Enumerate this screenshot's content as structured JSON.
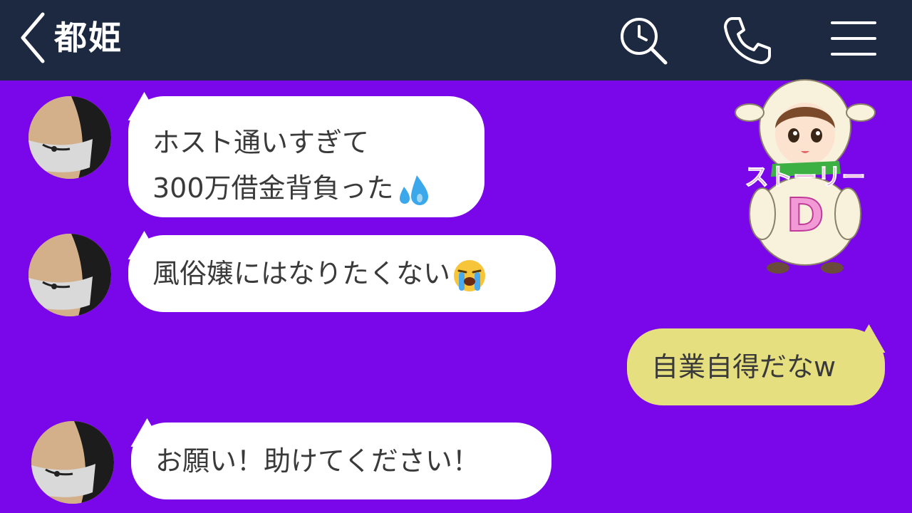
{
  "header": {
    "title": "都姫",
    "icons": [
      "chevron-left-icon",
      "search-clock-icon",
      "phone-icon",
      "menu-icon"
    ]
  },
  "colors": {
    "header_bg": "#1d2940",
    "chat_bg": "#7a06ea",
    "incoming_bubble": "#ffffff",
    "outgoing_bubble": "#e6df80",
    "text": "#3a3a3a"
  },
  "messages": [
    {
      "side": "left",
      "lines": [
        "ホスト通いすぎて",
        "300万借金背負った"
      ],
      "emoji": "sweat-droplets-emoji"
    },
    {
      "side": "left",
      "lines": [
        "風俗嬢にはなりたくない"
      ],
      "emoji": "loudly-crying-face-emoji"
    },
    {
      "side": "right",
      "lines": [
        "自業自得だなw"
      ]
    },
    {
      "side": "left",
      "lines": [
        "お願い！助けてください！"
      ]
    }
  ],
  "sticker": {
    "text": "ストーリー",
    "letter": "D"
  }
}
